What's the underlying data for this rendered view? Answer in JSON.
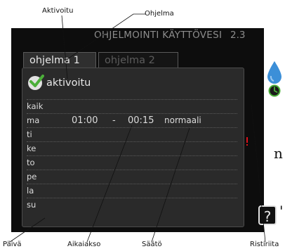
{
  "callouts": {
    "aktivoitu": "Aktivoitu",
    "ohjelma": "Ohjelma",
    "paiva": "Päivä",
    "aikaiakso": "Aikaiakso",
    "saato": "Säätö",
    "ristiriita": "Ristiriita"
  },
  "background_text": [
    "n",
    "'"
  ],
  "screen": {
    "title": "OHJELMOINTI KÄYTTÖVESI",
    "menu_number": "2.3",
    "tabs": [
      {
        "label": "ohjelma 1",
        "active": true
      },
      {
        "label": "ohjelma 2",
        "active": false
      }
    ],
    "activated_label": "aktivoitu",
    "activated": true,
    "days": [
      {
        "label": "kaik",
        "start": "",
        "dash": "",
        "end": "",
        "mode": ""
      },
      {
        "label": "ma",
        "start": "01:00",
        "dash": "-",
        "end": "00:15",
        "mode": "normaali"
      },
      {
        "label": "ti",
        "start": "",
        "dash": "",
        "end": "",
        "mode": ""
      },
      {
        "label": "ke",
        "start": "",
        "dash": "",
        "end": "",
        "mode": ""
      },
      {
        "label": "to",
        "start": "",
        "dash": "",
        "end": "",
        "mode": ""
      },
      {
        "label": "pe",
        "start": "",
        "dash": "",
        "end": "",
        "mode": ""
      },
      {
        "label": "la",
        "start": "",
        "dash": "",
        "end": "",
        "mode": ""
      },
      {
        "label": "su",
        "start": "",
        "dash": "",
        "end": "",
        "mode": ""
      }
    ],
    "conflict_symbol": "!",
    "help_symbol": "?",
    "icons": [
      "water-drop-icon",
      "clock-icon",
      "help-icon",
      "check-icon"
    ],
    "colors": {
      "screen_bg": "#0d0d0d",
      "panel_bg": "#2a2a2a",
      "header_text": "#8c8c8c",
      "accent_green": "#4caf3a",
      "conflict_red": "#e0101a",
      "drop_blue": "#3c8fd8"
    }
  }
}
